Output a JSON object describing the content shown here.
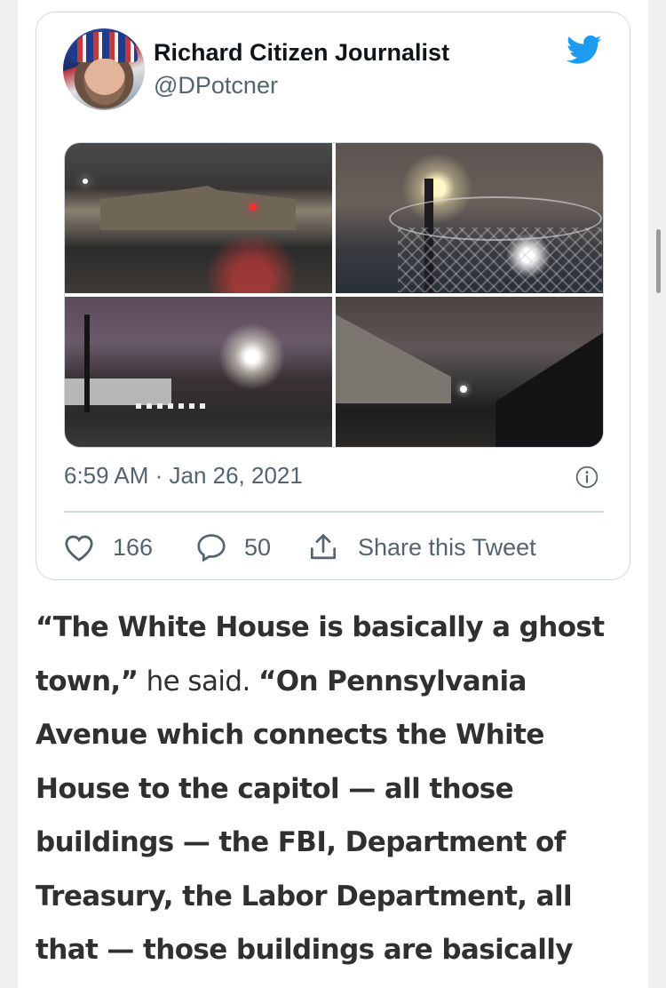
{
  "tweet": {
    "author_name": "Richard Citizen Journalist",
    "author_handle": "@DPotcner",
    "timestamp": "6:59 AM · Jan 26, 2021",
    "likes": "166",
    "replies": "50",
    "share_label": "Share this Tweet",
    "brand_color": "#1d9bf0",
    "icons": [
      "twitter-bird-icon",
      "info-icon",
      "heart-icon",
      "reply-bubble-icon",
      "share-icon"
    ]
  },
  "article": {
    "quote_part1": "“The White House is basically a ghost town,”",
    "attribution": " he said. ",
    "quote_part2": "“On Pennsylvania Avenue which connects the White House to the capitol — all those buildings — the FBI, Department of Treasury, the Labor Department, all that — those buildings are basically abandon.”"
  }
}
